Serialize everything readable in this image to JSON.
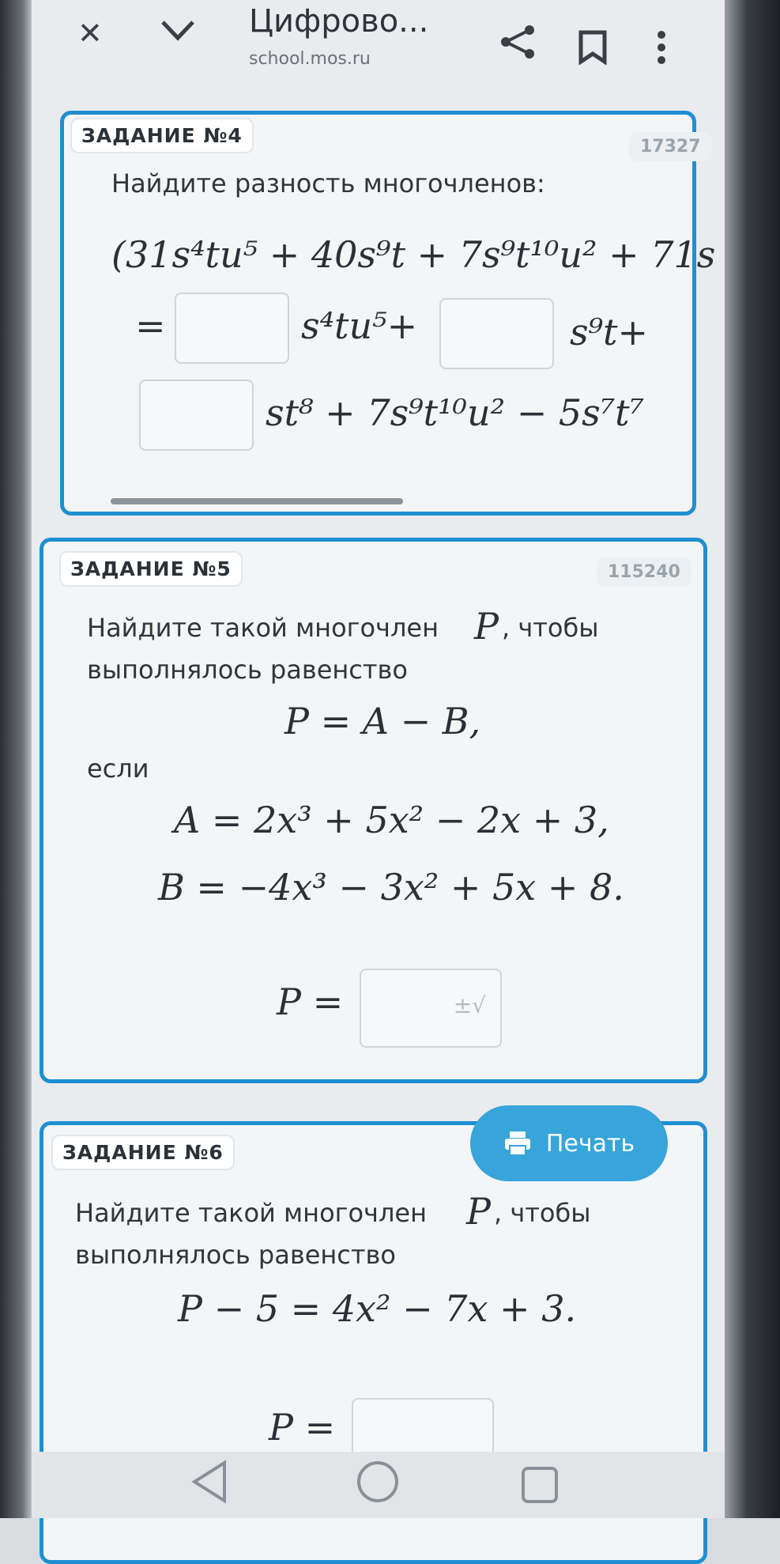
{
  "header": {
    "title": "Цифрово...",
    "url": "school.mos.ru",
    "icons": [
      "close-icon",
      "chevron-down-icon",
      "share-icon",
      "bookmark-icon",
      "more-icon"
    ]
  },
  "task4": {
    "tag": "ЗАДАНИЕ №4",
    "qid": "17327",
    "prompt": "Найдите разность многочленов:",
    "line1": "(31s⁴tu⁵ + 40s⁹t + 7s⁹t¹⁰u² + 71s",
    "line2_eq": "=",
    "line2_t1": "s⁴tu⁵+",
    "line2_t2": "s⁹t+",
    "line3": "st⁸ + 7s⁹t¹⁰u² − 5s⁷t⁷"
  },
  "task5": {
    "tag": "ЗАДАНИЕ №5",
    "qid": "115240",
    "prompt1": "Найдите такой многочлен",
    "var": "P",
    "prompt2": ", чтобы",
    "prompt3": "выполнялось равенство",
    "eq": "P = A − B,",
    "if": "если",
    "a": "A = 2x³ + 5x² − 2x + 3,",
    "b": "B = −4x³ − 3x² + 5x + 8.",
    "answer": "P ="
  },
  "task6": {
    "tag": "ЗАДАНИЕ №6",
    "prompt1": "Найдите такой многочлен",
    "var": "P",
    "prompt2": ", чтобы",
    "prompt3": "выполнялось равенство",
    "eq": "P − 5 = 4x² − 7x + 3.",
    "answer": "P ="
  },
  "print_button": {
    "label": "Печать"
  },
  "nav": {
    "icons": [
      "back-icon",
      "home-icon",
      "recents-icon"
    ]
  }
}
